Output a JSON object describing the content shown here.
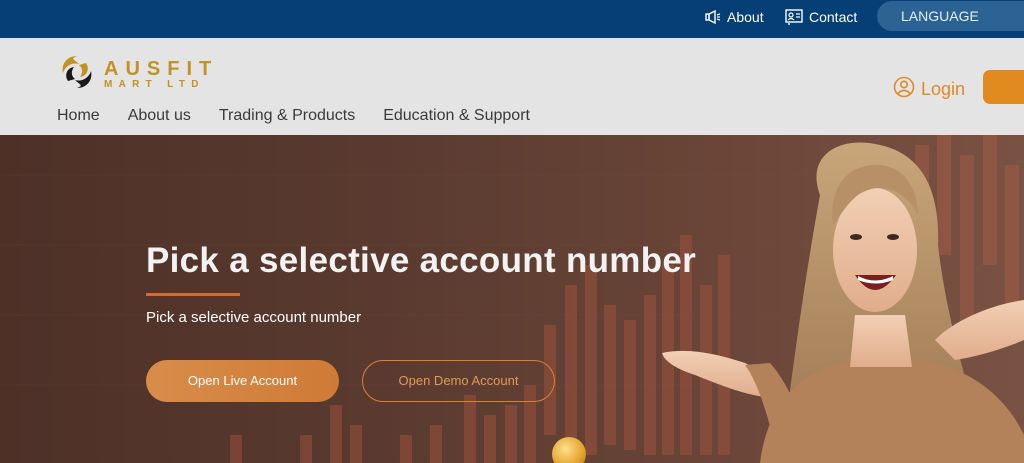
{
  "topbar": {
    "about_label": "About",
    "contact_label": "Contact",
    "language_label": "LANGUAGE"
  },
  "brand": {
    "name": "AUSFIT",
    "sub": "MART LTD",
    "color": "#c39321"
  },
  "nav": {
    "items": [
      {
        "label": "Home"
      },
      {
        "label": "About us"
      },
      {
        "label": "Trading & Products"
      },
      {
        "label": "Education & Support"
      }
    ]
  },
  "header": {
    "login_label": "Login",
    "accent_color": "#e08a20"
  },
  "hero": {
    "title": "Pick a selective account number",
    "subtitle": "Pick a selective account number",
    "live_button_label": "Open Live Account",
    "demo_button_label": "Open Demo Account"
  }
}
